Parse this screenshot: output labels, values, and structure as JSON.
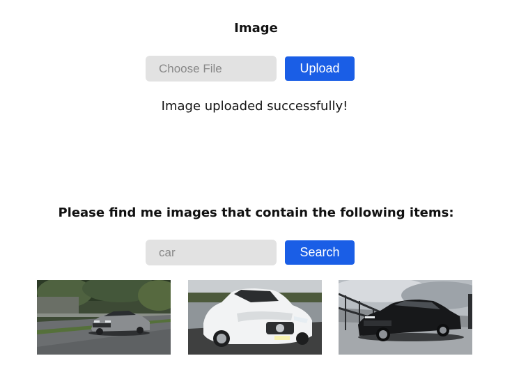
{
  "upload_section": {
    "title": "Image",
    "file_input_label": "Choose File",
    "upload_button_label": "Upload",
    "status_message": "Image uploaded successfully!"
  },
  "search_section": {
    "title": "Please find me images that contain the following items:",
    "query_placeholder": "car",
    "search_button_label": "Search"
  },
  "results": [
    {
      "subject": "grey sedan on road"
    },
    {
      "subject": "white convertible coupe"
    },
    {
      "subject": "black luxury sedan on bridge"
    }
  ],
  "colors": {
    "accent": "#1a5ee6",
    "field_background": "#e2e2e2"
  }
}
